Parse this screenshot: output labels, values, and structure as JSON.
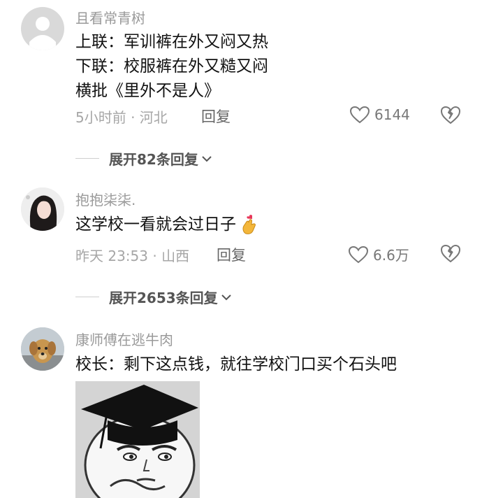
{
  "comments": [
    {
      "username": "且看常青树",
      "lines": [
        "上联：军训裤在外又闷又热",
        "下联：校服裤在外又糙又闷",
        "横批《里外不是人》"
      ],
      "meta": "5小时前 · 河北",
      "reply_label": "回复",
      "likes": "6144",
      "expand_label": "展开82条回复",
      "avatar_icon": "default-avatar-icon"
    },
    {
      "username": "抱抱柒柒.",
      "lines": [
        "这学校一看就会过日子"
      ],
      "emoji": "finger-heart-emoji",
      "meta": "昨天 23:53 · 山西",
      "reply_label": "回复",
      "likes": "6.6万",
      "expand_label": "展开2653条回复",
      "avatar_icon": "girl-photo-avatar"
    },
    {
      "username": "康师傅在逃牛肉",
      "lines": [
        "校长：剩下这点钱，就往学校门口买个石头吧"
      ],
      "avatar_icon": "dog-photo-avatar",
      "sticker_icon": "graduation-cap-meme-sticker"
    }
  ],
  "colors": {
    "username": "#9a9a9a",
    "text": "#111111",
    "meta": "#a6a6a6",
    "expand": "#555555"
  }
}
